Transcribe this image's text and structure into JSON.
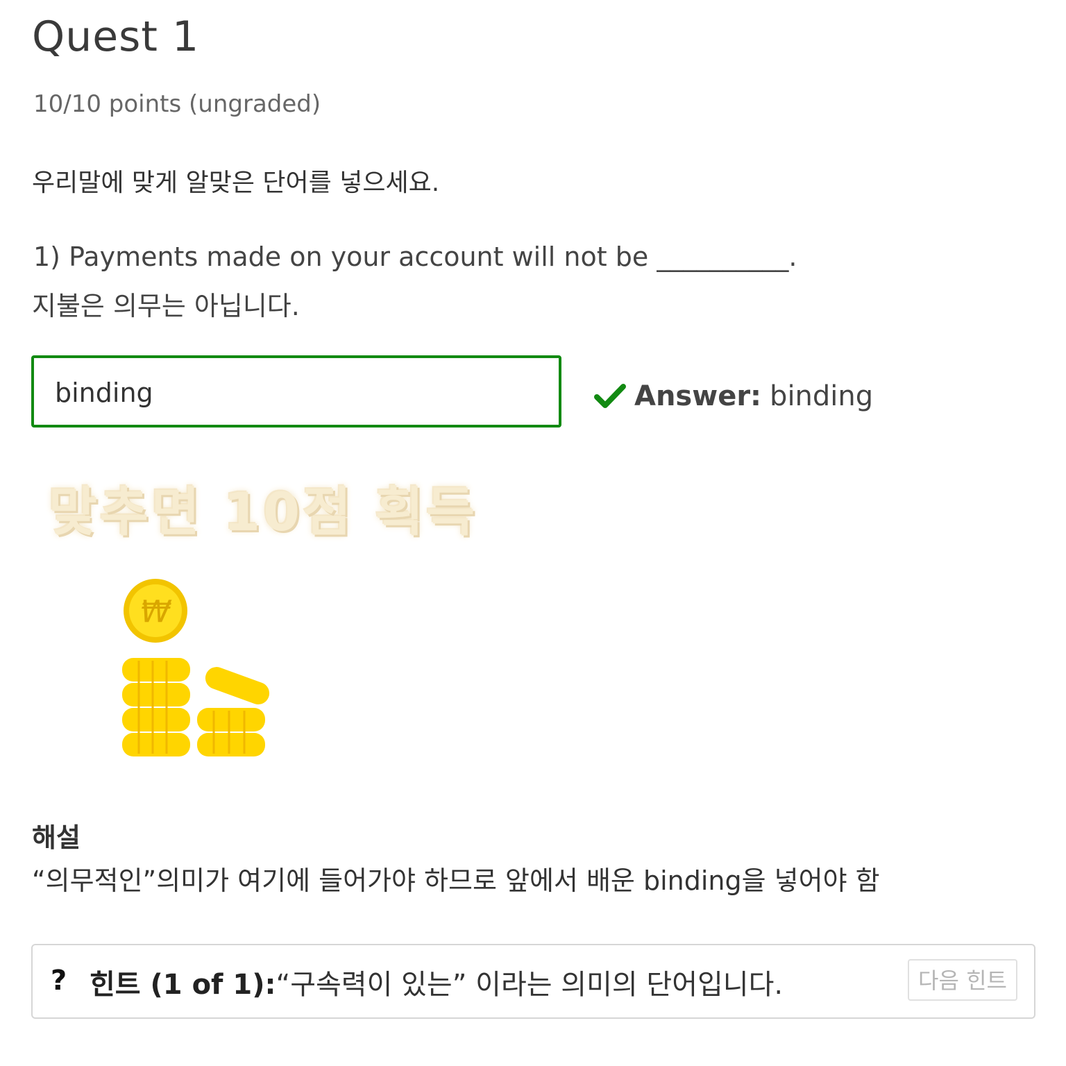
{
  "quest": {
    "title": "Quest 1",
    "points": "10/10 points (ungraded)"
  },
  "problem": {
    "instruction": "우리말에 맞게 알맞은 단어를 넣으세요.",
    "question": "1) Payments made on your account will not be __________.",
    "translation": "지불은 의무는 아닙니다.",
    "input_value": "binding"
  },
  "feedback": {
    "icon": "checkmark-icon",
    "label": "Answer:",
    "value": "binding",
    "color": "#128a12"
  },
  "reward": {
    "banner": "맞추면 10점 획득",
    "image_icon": "coin-stack-icon",
    "coin_symbol": "₩"
  },
  "explanation": {
    "heading": "해설",
    "text": "“의무적인”의미가 여기에 들어가야 하므로 앞에서 배운 binding을 넣어야 함"
  },
  "hint": {
    "icon": "?",
    "label": "힌트 (1 of 1):",
    "text": "“구속력이 있는” 이라는 의미의 단어입니다.",
    "next_button": "다음 힌트"
  }
}
